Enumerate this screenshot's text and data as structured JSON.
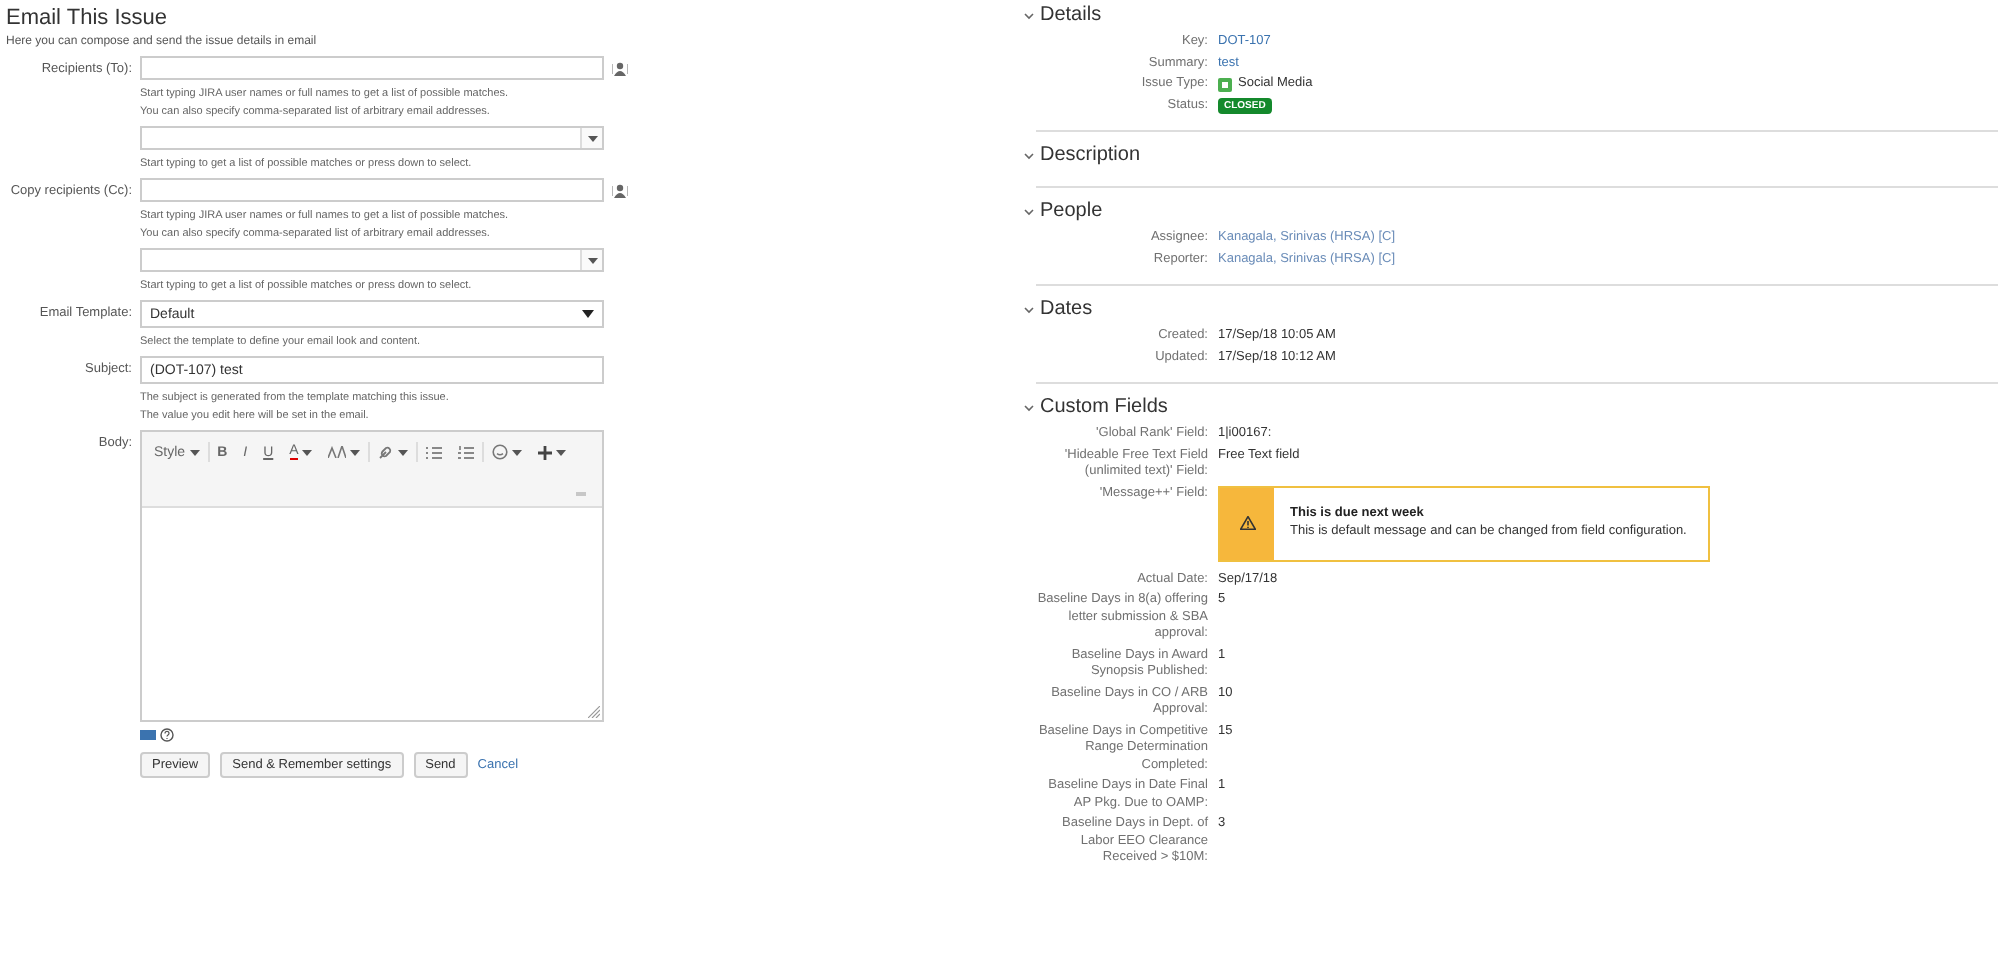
{
  "email_form": {
    "title": "Email This Issue",
    "intro": "Here you can compose and send the issue details in email",
    "fields": [
      {
        "kind": "people",
        "label": "Recipients (To):",
        "hints": [
          "Start typing JIRA user names or full names to get a list of possible matches.",
          "You can also specify comma-separated list of arbitrary email addresses."
        ]
      },
      {
        "kind": "picker",
        "hints": [
          "Start typing to get a list of possible matches or press down to select."
        ]
      },
      {
        "kind": "people",
        "label": "Copy recipients (Cc):",
        "hints": [
          "Start typing JIRA user names or full names to get a list of possible matches.",
          "You can also specify comma-separated list of arbitrary email addresses."
        ]
      },
      {
        "kind": "picker",
        "hints": [
          "Start typing to get a list of possible matches or press down to select."
        ]
      },
      {
        "kind": "select",
        "label": "Email Template:",
        "value": "Default",
        "hints": [
          "Select the template to define your email look and content."
        ]
      },
      {
        "kind": "text",
        "label": "Subject:",
        "value": "(DOT-107) test",
        "hints": [
          "The subject is generated from the template matching this issue.",
          "The value you edit here will be set in the email."
        ]
      },
      {
        "kind": "editor",
        "label": "Body:"
      }
    ],
    "toolbar": [
      {
        "kind": "text",
        "label": "Style",
        "dropdown": true,
        "divider": true
      },
      {
        "kind": "bold",
        "label": "B",
        "dropdown": false,
        "divider": false
      },
      {
        "kind": "italic",
        "label": "I",
        "dropdown": false,
        "divider": false
      },
      {
        "kind": "underline",
        "label": "U",
        "dropdown": false,
        "divider": false
      },
      {
        "kind": "color",
        "label": "A",
        "dropdown": true,
        "divider": false
      },
      {
        "kind": "size",
        "dropdown": true,
        "divider": true
      },
      {
        "kind": "link",
        "dropdown": true,
        "divider": true
      },
      {
        "kind": "bullets",
        "dropdown": false,
        "divider": false
      },
      {
        "kind": "numbers",
        "dropdown": false,
        "divider": true
      },
      {
        "kind": "emoji",
        "dropdown": true,
        "divider": false
      },
      {
        "kind": "plus",
        "dropdown": true,
        "divider": false
      }
    ],
    "buttons": [
      {
        "label": "Preview",
        "kind": "button"
      },
      {
        "label": "Send & Remember settings",
        "kind": "button"
      },
      {
        "label": "Send",
        "kind": "button"
      },
      {
        "label": "Cancel",
        "kind": "link"
      }
    ]
  },
  "issue": {
    "sections": [
      {
        "title": "Details",
        "expanded": true,
        "fields": [
          {
            "label": "Key:",
            "kind": "link",
            "value": "DOT-107"
          },
          {
            "label": "Summary:",
            "kind": "link",
            "value": "test"
          },
          {
            "label": "Issue Type:",
            "kind": "type",
            "value": "Social Media"
          },
          {
            "label": "Status:",
            "kind": "status",
            "value": "CLOSED"
          }
        ]
      },
      {
        "title": "Description",
        "expanded": true
      },
      {
        "title": "People",
        "expanded": true,
        "fields": [
          {
            "label": "Assignee:",
            "kind": "user",
            "value": "Kanagala, Srinivas (HRSA) [C]"
          },
          {
            "label": "Reporter:",
            "kind": "user",
            "value": "Kanagala, Srinivas (HRSA) [C]"
          }
        ]
      },
      {
        "title": "Dates",
        "expanded": true,
        "fields": [
          {
            "label": "Created:",
            "kind": "text",
            "value": "17/Sep/18 10:05 AM"
          },
          {
            "label": "Updated:",
            "kind": "text",
            "value": "17/Sep/18 10:12 AM"
          }
        ]
      },
      {
        "title": "Custom Fields",
        "expanded": true,
        "fields": [
          {
            "label": "'Global Rank' Field:",
            "kind": "text",
            "value": "1|i00167:"
          },
          {
            "label": "'Hideable Free Text Field (unlimited text)' Field:",
            "kind": "text",
            "value": "Free Text field"
          },
          {
            "label": "'Message++' Field:",
            "kind": "message",
            "title": "This is due next week",
            "value": "This is default message and can be changed from field configuration."
          },
          {
            "label": "Actual Date:",
            "kind": "text",
            "value": "Sep/17/18"
          },
          {
            "label": "Baseline Days in 8(a) offering letter submission & SBA approval:",
            "kind": "text",
            "value": "5"
          },
          {
            "label": "Baseline Days in Award Synopsis Published:",
            "kind": "text",
            "value": "1"
          },
          {
            "label": "Baseline Days in CO / ARB Approval:",
            "kind": "text",
            "value": "10"
          },
          {
            "label": "Baseline Days in Competitive Range Determination Completed:",
            "kind": "text",
            "value": "15"
          },
          {
            "label": "Baseline Days in Date Final AP Pkg. Due to OAMP:",
            "kind": "text",
            "value": "1"
          },
          {
            "label": "Baseline Days in Dept. of Labor EEO Clearance Received > $10M:",
            "kind": "text",
            "value": "3"
          }
        ]
      }
    ]
  }
}
